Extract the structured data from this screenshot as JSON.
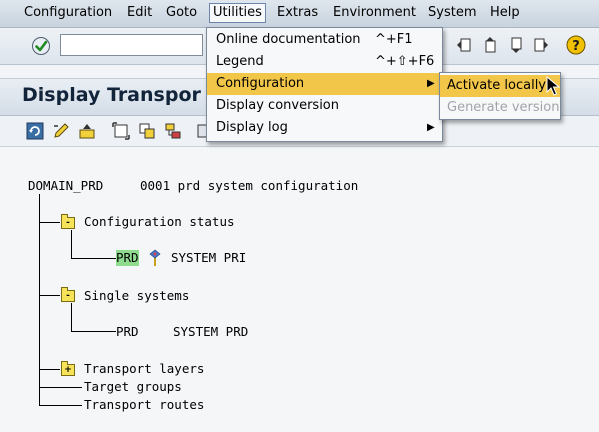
{
  "menubar": {
    "items": [
      {
        "label": "Configuration"
      },
      {
        "label": "Edit"
      },
      {
        "label": "Goto"
      },
      {
        "label": "Utilities"
      },
      {
        "label": "Extras"
      },
      {
        "label": "Environment"
      },
      {
        "label": "System"
      },
      {
        "label": "Help"
      }
    ]
  },
  "toolbar": {
    "command_field_value": "",
    "icons": [
      "ok-icon",
      "first-page-icon",
      "previous-page-icon",
      "next-page-icon",
      "last-page-icon",
      "help-icon"
    ]
  },
  "title": "Display Transpor",
  "dropdown": {
    "items": [
      {
        "label": "Online documentation",
        "shortcut": "^+F1"
      },
      {
        "label": "Legend",
        "shortcut": "^+⇧+F6"
      },
      {
        "label": "Configuration",
        "shortcut": "",
        "submenu": true
      },
      {
        "label": "Display conversion",
        "shortcut": ""
      },
      {
        "label": "Display log",
        "shortcut": "",
        "submenu": true
      }
    ]
  },
  "submenu": {
    "items": [
      {
        "label": "Activate locally",
        "enabled": true
      },
      {
        "label": "Generate version",
        "enabled": false
      }
    ]
  },
  "tree": {
    "root_name": "DOMAIN_PRD",
    "root_desc": "0001 prd system configuration",
    "config_status": "Configuration status",
    "prd1_name": "PRD",
    "prd1_desc": "SYSTEM PRI",
    "single_systems": "Single systems",
    "prd2_name": "PRD",
    "prd2_desc": "SYSTEM PRD",
    "transport_layers": "Transport layers",
    "target_groups": "Target groups",
    "transport_routes": "Transport routes",
    "folder_expanded_symbol": "-",
    "folder_collapsed_symbol": "+"
  },
  "colors": {
    "highlight": "#f2c649",
    "prd_highlight": "#8fdc8f",
    "folder": "#f6e35a"
  }
}
